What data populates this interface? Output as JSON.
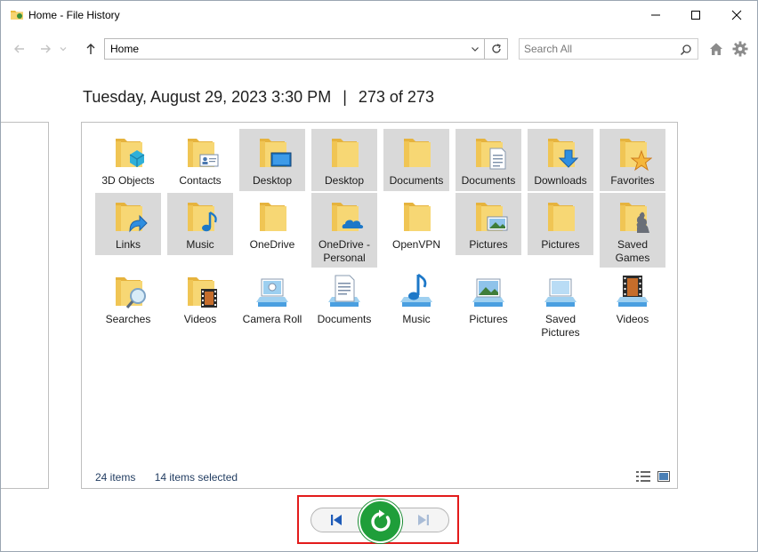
{
  "window": {
    "title": "Home - File History"
  },
  "nav": {
    "address": "Home",
    "search_placeholder": "Search All"
  },
  "heading": {
    "date": "Tuesday, August 29, 2023 3:30 PM",
    "separator": "|",
    "position": "273 of 273"
  },
  "items": [
    {
      "label": "3D Objects",
      "icon": "folder-3d-objects-icon",
      "selected": false
    },
    {
      "label": "Contacts",
      "icon": "folder-contacts-icon",
      "selected": false
    },
    {
      "label": "Desktop",
      "icon": "folder-desktop-icon",
      "selected": true
    },
    {
      "label": "Desktop",
      "icon": "folder-icon",
      "selected": true
    },
    {
      "label": "Documents",
      "icon": "folder-icon",
      "selected": true
    },
    {
      "label": "Documents",
      "icon": "folder-documents-icon",
      "selected": true
    },
    {
      "label": "Downloads",
      "icon": "folder-downloads-icon",
      "selected": true
    },
    {
      "label": "Favorites",
      "icon": "folder-favorites-icon",
      "selected": true
    },
    {
      "label": "Links",
      "icon": "folder-links-icon",
      "selected": true
    },
    {
      "label": "Music",
      "icon": "folder-music-icon",
      "selected": true
    },
    {
      "label": "OneDrive",
      "icon": "folder-icon",
      "selected": false
    },
    {
      "label": "OneDrive - Personal",
      "icon": "folder-onedrive-icon",
      "selected": true
    },
    {
      "label": "OpenVPN",
      "icon": "folder-icon",
      "selected": false
    },
    {
      "label": "Pictures",
      "icon": "folder-pictures-icon",
      "selected": true
    },
    {
      "label": "Pictures",
      "icon": "folder-icon",
      "selected": true
    },
    {
      "label": "Saved Games",
      "icon": "folder-saved-games-icon",
      "selected": true
    },
    {
      "label": "Searches",
      "icon": "folder-searches-icon",
      "selected": false
    },
    {
      "label": "Videos",
      "icon": "folder-videos-icon",
      "selected": false
    },
    {
      "label": "Camera Roll",
      "icon": "library-camera-roll-icon",
      "selected": false
    },
    {
      "label": "Documents",
      "icon": "library-documents-icon",
      "selected": false
    },
    {
      "label": "Music",
      "icon": "library-music-icon",
      "selected": false
    },
    {
      "label": "Pictures",
      "icon": "library-pictures-icon",
      "selected": false
    },
    {
      "label": "Saved Pictures",
      "icon": "library-saved-pictures-icon",
      "selected": false
    },
    {
      "label": "Videos",
      "icon": "library-videos-icon",
      "selected": false
    }
  ],
  "status": {
    "count": "24 items",
    "selected": "14 items selected"
  },
  "colors": {
    "selected_tile": "#d9d9d9",
    "restore_green": "#1f9e3a",
    "highlight_frame": "#e31b1b",
    "folder_yellow": "#f5c94f"
  }
}
